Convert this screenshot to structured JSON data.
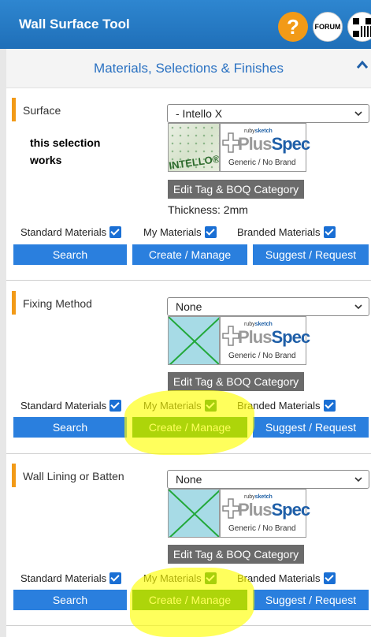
{
  "app": {
    "title": "Wall Surface Tool"
  },
  "header_buttons": {
    "help": "?",
    "forum": "FORUM"
  },
  "section": {
    "title": "Materials, Selections & Finishes"
  },
  "groups": [
    {
      "label": "Surface",
      "note": "this selection works",
      "selected": "- Intello X",
      "thumbnail_text": "INTELLO®X PLUS",
      "plusspec": {
        "ruby": "ruby",
        "sketch": "sketch",
        "plus": "Plus",
        "spec": "Spec",
        "generic": "Generic / No Brand"
      },
      "tag_button": "Edit Tag & BOQ Category",
      "thickness": "Thickness: 2mm",
      "checkboxes": [
        "Standard Materials",
        "My Materials",
        "Branded Materials"
      ],
      "buttons": [
        "Search",
        "Create / Manage",
        "Suggest / Request"
      ]
    },
    {
      "label": "Fixing Method",
      "selected": "None",
      "plusspec": {
        "ruby": "ruby",
        "sketch": "sketch",
        "plus": "Plus",
        "spec": "Spec",
        "generic": "Generic / No Brand"
      },
      "tag_button": "Edit Tag & BOQ Category",
      "checkboxes": [
        "Standard Materials",
        "My Materials",
        "Branded Materials"
      ],
      "buttons": [
        "Search",
        "Create / Manage",
        "Suggest / Request"
      ]
    },
    {
      "label": "Wall Lining or Batten",
      "selected": "None",
      "plusspec": {
        "ruby": "ruby",
        "sketch": "sketch",
        "plus": "Plus",
        "spec": "Spec",
        "generic": "Generic / No Brand"
      },
      "tag_button": "Edit Tag & BOQ Category",
      "checkboxes": [
        "Standard Materials",
        "My Materials",
        "Branded Materials"
      ],
      "buttons": [
        "Search",
        "Create / Manage",
        "Suggest / Request"
      ]
    }
  ],
  "colors": {
    "header": "#2e86d0",
    "accent": "#f29a17",
    "button": "#2a7fde",
    "highlight": "#ffff00"
  }
}
